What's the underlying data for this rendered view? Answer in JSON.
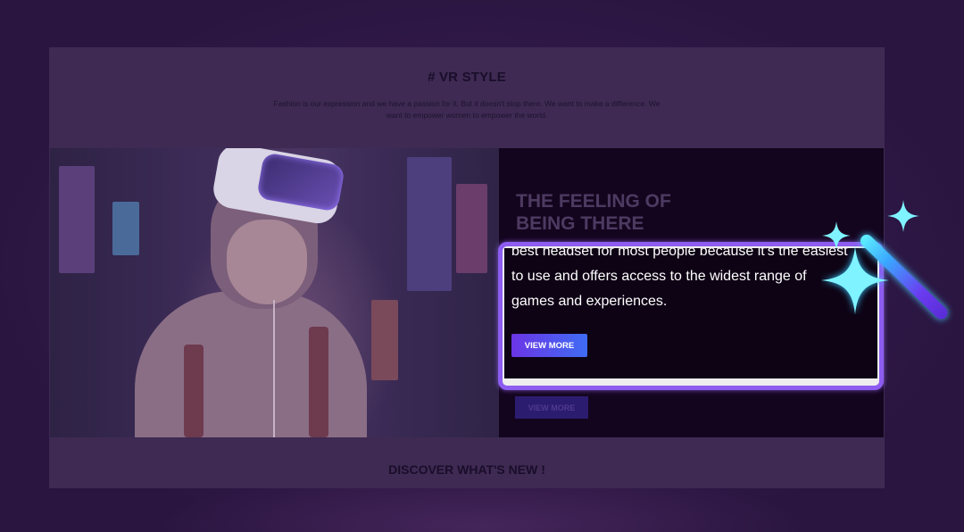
{
  "page": {
    "title": "# VR STYLE",
    "intro": "Fashion is our expression and we have a passion for it. But it doesn't stop there. We want to make a difference.  We want to empower women to empower the world.",
    "section_heading": "DISCOVER WHAT'S NEW !"
  },
  "hero": {
    "title": "THE FEELING OF BEING THERE",
    "button_dim_label": "VIEW MORE"
  },
  "selection": {
    "text": "best headset for most people because it's the easiest to use and offers access to the widest range of games and experiences.",
    "button_label": "VIEW MORE"
  },
  "icons": {
    "wand": "magic-wand-icon",
    "sparkles": "sparkle-icon"
  },
  "colors": {
    "accent": "#8d5cf0",
    "button_gradient_start": "#6b35e6",
    "button_gradient_end": "#3f6cf4",
    "sparkle": "#7ff3ff"
  }
}
